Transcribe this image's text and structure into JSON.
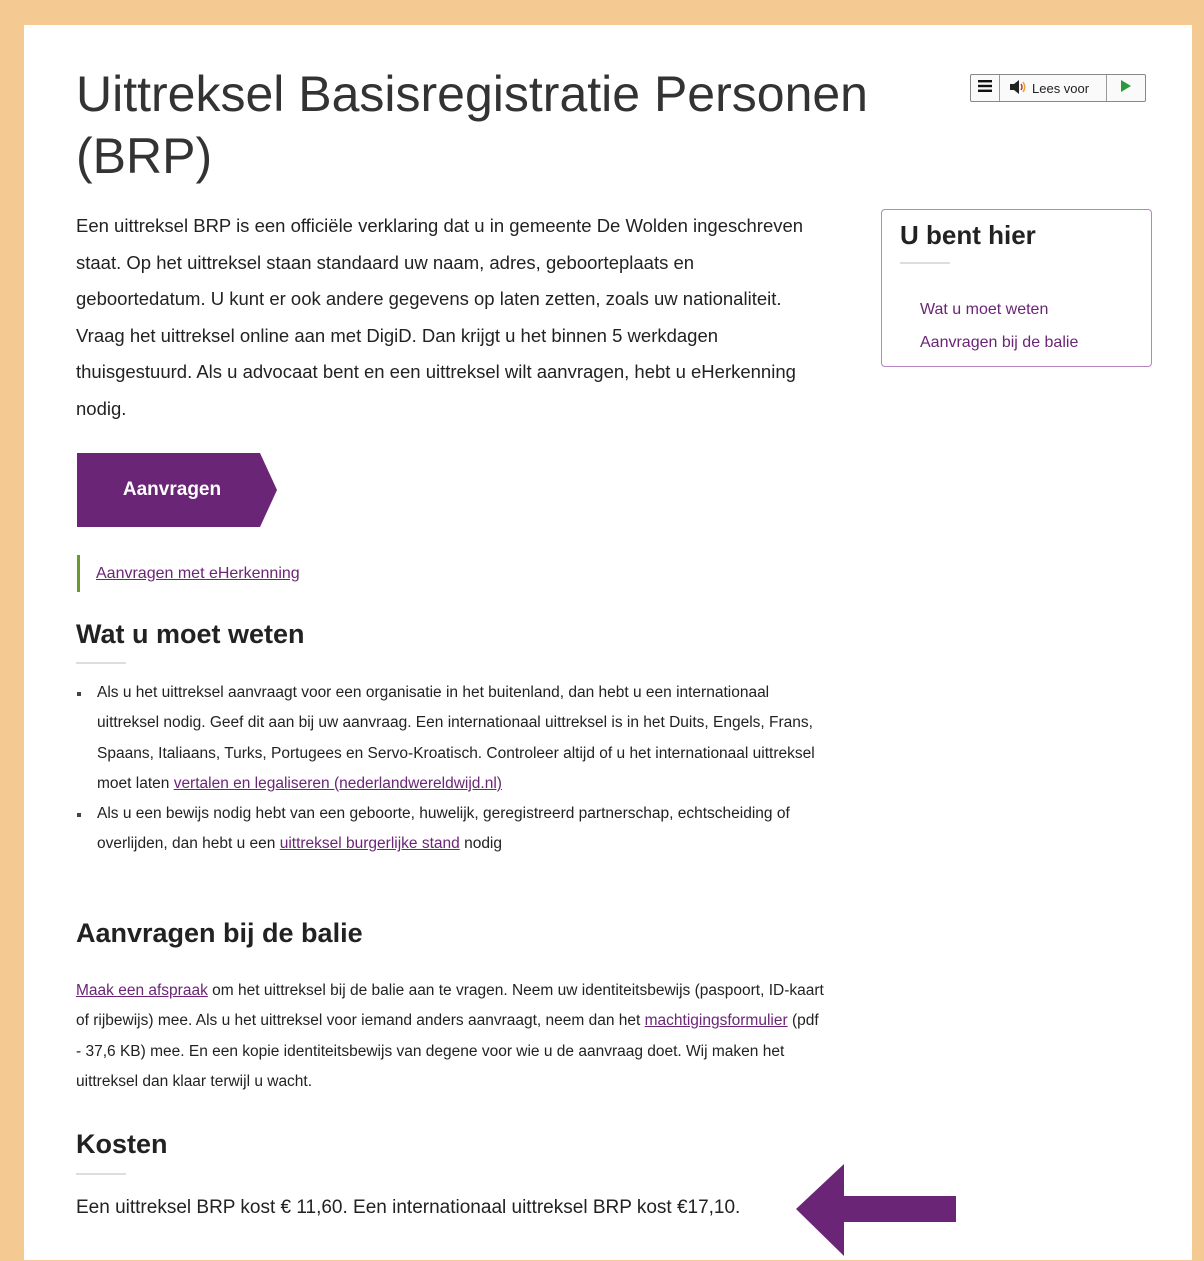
{
  "title": "Uittreksel Basisregistratie Personen (BRP)",
  "readspeaker": {
    "menu_icon": "menu-icon",
    "speaker_icon": "speaker-icon",
    "label": "Lees voor",
    "play_icon": "play-icon"
  },
  "intro": "Een uittreksel BRP is een officiële verklaring dat u in gemeente De Wolden ingeschreven staat. Op het uittreksel staan standaard uw naam, adres, geboorteplaats en geboortedatum. U kunt er ook andere gegevens op laten zetten, zoals uw nationaliteit. Vraag het uittreksel online aan met DigiD. Dan krijgt u het binnen 5 werkdagen thuisgestuurd. Als u advocaat bent en een uittreksel wilt aanvragen, hebt u eHerkenning nodig.",
  "cta_label": "Aanvragen",
  "alt_link": "Aanvragen met eHerkenning",
  "sidebar": {
    "title": "U bent hier",
    "items": [
      "Wat u moet weten",
      "Aanvragen bij de balie"
    ]
  },
  "wat": {
    "heading": "Wat u moet weten",
    "b1_text": "Als u het uittreksel aanvraagt voor een organisatie in het buitenland, dan hebt u een internationaal uittreksel nodig. Geef dit aan bij uw aanvraag. Een internationaal uittreksel is in het Duits, Engels, Frans, Spaans, Italiaans, Turks, Portugees en Servo-Kroatisch. Controleer altijd of u het internationaal uittreksel moet laten ",
    "b1_link": "vertalen en legaliseren (nederlandwereldwijd.nl)",
    "b2_text": "Als u een bewijs nodig hebt van een geboorte, huwelijk, geregistreerd partnerschap, echtscheiding of overlijden, dan hebt u een ",
    "b2_link": "uittreksel burgerlijke stand",
    "b2_after": " nodig"
  },
  "balie": {
    "heading": "Aanvragen bij de balie",
    "link1": "Maak een afspraak",
    "text1": " om het uittreksel bij de balie aan te vragen. Neem uw identiteitsbewijs (paspoort, ID-kaart of rijbewijs) mee. Als u het uittreksel voor iemand anders aanvraagt, neem dan het ",
    "link2": "machtigingsformulier",
    "text2": " (pdf - 37,6 KB) mee. En een kopie identiteitsbewijs van degene voor wie u de aanvraag doet. Wij maken het uittreksel dan klaar terwijl u wacht."
  },
  "kosten": {
    "heading": "Kosten",
    "text": "Een uittreksel BRP kost € 11,60. Een internationaal uittreksel BRP kost €17,10."
  },
  "colors": {
    "accent": "#6b2576",
    "frame": "#f5c992",
    "link_bar": "#6a9a2a"
  },
  "annotation_icon": "left-arrow-annotation"
}
